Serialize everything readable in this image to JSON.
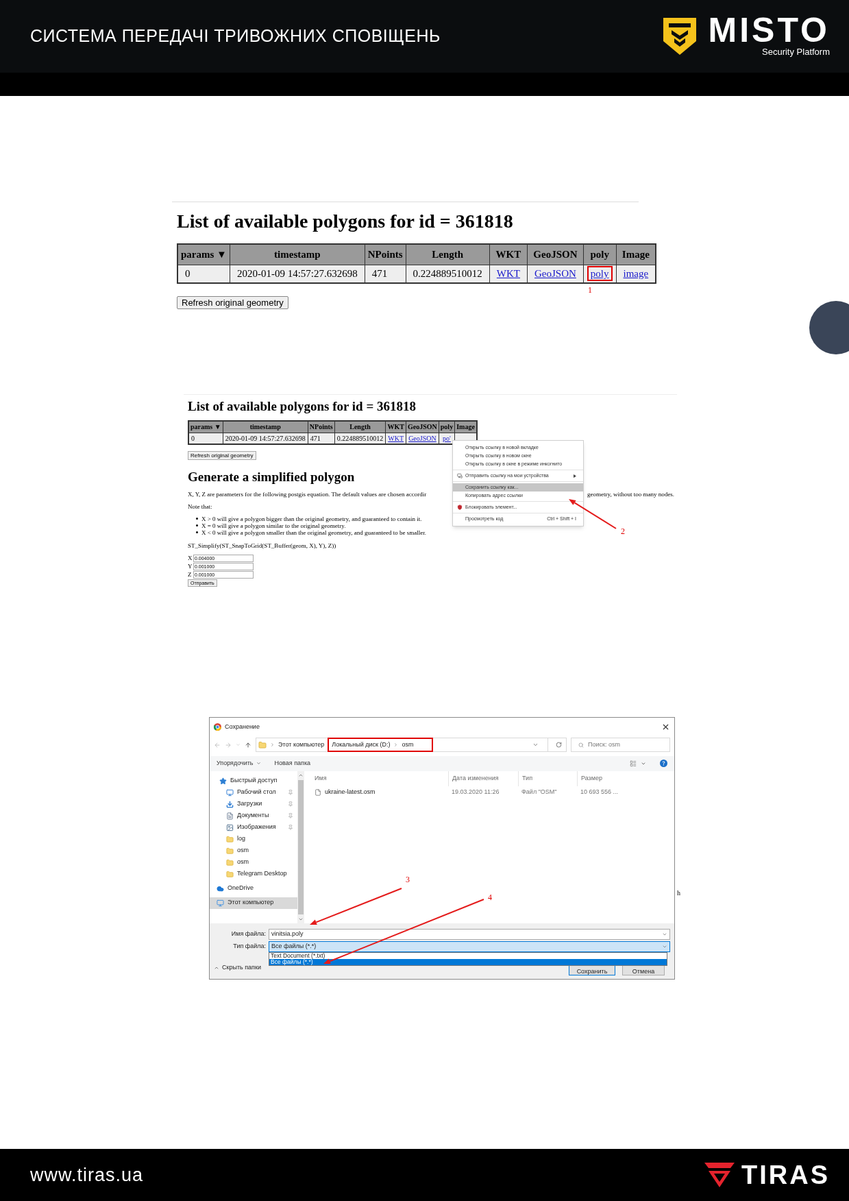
{
  "header": {
    "title": "СИСТЕМА ПЕРЕДАЧІ ТРИВОЖНИХ СПОВІЩЕНЬ",
    "brand": "MISTO",
    "tagline": "Security Platform"
  },
  "polygons_page": {
    "heading": "List of available polygons for id = 361818",
    "columns": [
      "params ▼",
      "timestamp",
      "NPoints",
      "Length",
      "WKT",
      "GeoJSON",
      "poly",
      "Image"
    ],
    "row": [
      {
        "text": "0",
        "kind": "text",
        "highlighted": false
      },
      {
        "text": "2020-01-09 14:57:27.632698",
        "kind": "text",
        "highlighted": false
      },
      {
        "text": "471",
        "kind": "text",
        "highlighted": false
      },
      {
        "text": "0.224889510012",
        "kind": "number",
        "highlighted": false
      },
      {
        "text": "WKT",
        "kind": "link",
        "highlighted": false
      },
      {
        "text": "GeoJSON",
        "kind": "link",
        "highlighted": false
      },
      {
        "text": "poly",
        "kind": "link",
        "highlighted": true
      },
      {
        "text": "image",
        "kind": "link",
        "highlighted": false
      }
    ],
    "button": "Refresh original geometry"
  },
  "simplify_page": {
    "heading": "List of available polygons for id = 361818",
    "columns": [
      "params ▼",
      "timestamp",
      "NPoints",
      "Length",
      "WKT",
      "GeoJSON",
      "poly",
      "Image"
    ],
    "row": [
      {
        "text": "0",
        "kind": "text"
      },
      {
        "text": "2020-01-09 14:57:27.632698",
        "kind": "text"
      },
      {
        "text": "471",
        "kind": "text"
      },
      {
        "text": "0.224889510012",
        "kind": "text"
      },
      {
        "text": "WKT",
        "kind": "link"
      },
      {
        "text": "GeoJSON",
        "kind": "link"
      },
      {
        "text": "po'",
        "kind": "link"
      }
    ],
    "button": "Refresh original geometry",
    "subheading": "Generate a simplified polygon",
    "paragraph_start": "X, Y, Z are parameters for the following postgis equation. The default values are chosen accordir",
    "paragraph_end": "geometry, without too many nodes.",
    "note": "Note that:",
    "bullets": [
      "X > 0 will give a polygon bigger than the original geometry, and guaranteed to contain it.",
      "X = 0 will give a polygon similar to the original geometry.",
      "X < 0 will give a polygon smaller than the original geometry, and guaranteed to be smaller."
    ],
    "formula": "ST_Simplify(ST_SnapToGrid(ST_Buffer(geom, X), Y), Z))",
    "fields": [
      {
        "label": "X",
        "value": "0.004000"
      },
      {
        "label": "Y",
        "value": "0.001000"
      },
      {
        "label": "Z",
        "value": "0.001000"
      }
    ],
    "submit": "Отправить",
    "context_menu": {
      "groups": [
        [
          {
            "label": "Открыть ссылку в новой вкладке",
            "kind": "plain",
            "selected": false
          },
          {
            "label": "Открыть ссылку в новом окне",
            "kind": "plain",
            "selected": false
          },
          {
            "label": "Открыть ссылку в окне в режиме инкогнито",
            "kind": "plain",
            "selected": false
          }
        ],
        [
          {
            "label": "Отправить ссылку на мои устройства",
            "kind": "submenu",
            "selected": false
          }
        ],
        [
          {
            "label": "Сохранить ссылку как...",
            "kind": "plain",
            "selected": true
          },
          {
            "label": "Копировать адрес ссылки",
            "kind": "plain",
            "selected": false
          }
        ],
        [
          {
            "label": "Блокировать элемент...",
            "kind": "blocker",
            "selected": false
          }
        ],
        [
          {
            "label": "Просмотреть код",
            "kind": "plain",
            "selected": false,
            "shortcut": "Ctrl + Shift + I"
          }
        ]
      ]
    }
  },
  "save_dialog": {
    "title": "Сохранение",
    "breadcrumb": [
      "Этот компьютер"
    ],
    "breadcrumb_highlighted": [
      "Локальный диск (D:)",
      "osm"
    ],
    "search": {
      "placeholder": "Поиск: osm"
    },
    "toolbar": [
      "Упорядочить",
      "Новая папка"
    ],
    "nav": [
      {
        "label": "Быстрый доступ",
        "kind": "star",
        "selected": false,
        "children": [
          {
            "label": "Рабочий стол",
            "kind": "desktop",
            "pinned": true,
            "selected": false
          },
          {
            "label": "Загрузки",
            "kind": "downloads",
            "pinned": true,
            "selected": false
          },
          {
            "label": "Документы",
            "kind": "documents",
            "pinned": true,
            "selected": false
          },
          {
            "label": "Изображения",
            "kind": "images",
            "pinned": true,
            "selected": false
          },
          {
            "label": "log",
            "kind": "folder",
            "pinned": false,
            "selected": false
          },
          {
            "label": "osm",
            "kind": "folder",
            "pinned": false,
            "selected": false
          },
          {
            "label": "osm",
            "kind": "folder",
            "pinned": false,
            "selected": false
          },
          {
            "label": "Telegram Desktop",
            "kind": "folder",
            "pinned": false,
            "selected": false
          }
        ]
      },
      {
        "label": "OneDrive",
        "kind": "cloud",
        "selected": false
      },
      {
        "label": "Этот компьютер",
        "kind": "computer",
        "selected": true
      }
    ],
    "columns": [
      "Имя",
      "Дата изменения",
      "Тип",
      "Размер"
    ],
    "files": [
      {
        "cells": [
          "ukraine-latest.osm",
          "19.03.2020 11:26",
          "Файл \"OSM\"",
          "10 693 556 ..."
        ]
      }
    ],
    "filename_label": "Имя файла:",
    "filename": "vinitsia.poly",
    "filetype_label": "Тип файла:",
    "filetype": "Все файлы (*.*)",
    "filetype_options": [
      {
        "label": "Text Document (*.txt)",
        "selected": false
      },
      {
        "label": "Все файлы (*.*)",
        "selected": true
      }
    ],
    "hide_folders": "Скрыть папки",
    "buttons": [
      "Сохранить",
      "Отмена"
    ]
  },
  "stray_text": "h",
  "annotations": [
    "1",
    "2",
    "3",
    "4"
  ],
  "footer": {
    "url": "www.tiras.ua",
    "brand": "TIRAS"
  }
}
